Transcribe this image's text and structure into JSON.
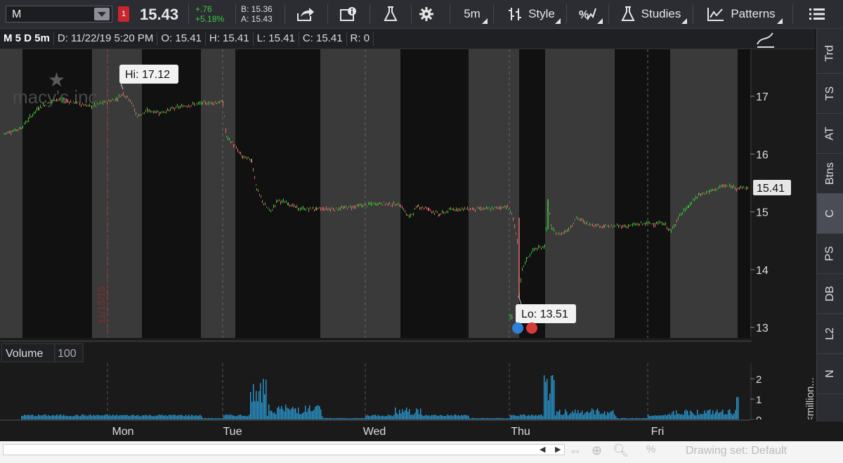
{
  "toolbar": {
    "symbol": "M",
    "alert_count": "1",
    "last_price": "15.43",
    "net_change": "+.76",
    "pct_change": "+5.18%",
    "bid": "B: 15.36",
    "ask": "A: 15.43",
    "timeframe": "5m",
    "style_label": "Style",
    "studies_label": "Studies",
    "patterns_label": "Patterns"
  },
  "infobar": {
    "title": "M 5 D 5m",
    "date": "D: 11/22/19 5:20 PM",
    "open": "O: 15.41",
    "high": "H: 15.41",
    "low": "L: 15.41",
    "close": "C: 15.41",
    "range": "R: 0"
  },
  "chart": {
    "watermark": "macy's inc",
    "hi_label": "Hi: 17.12",
    "lo_label": "Lo: 13.51",
    "price_label": "15.41",
    "date_marker": "11/15/19",
    "price_ticks": [
      "17",
      "16",
      "15",
      "14",
      "13"
    ],
    "day_labels": [
      "Mon",
      "Tue",
      "Wed",
      "Thu",
      "Fri"
    ],
    "volume_label": "Volume",
    "volume_value": "100",
    "volume_ticks": [
      "2",
      "1",
      "0"
    ],
    "volume_unit": "<million...",
    "up_color": "#2fcb2f",
    "down_color": "#e56b6b",
    "volume_color": "#2b9ad3"
  },
  "right_tabs": [
    "Trd",
    "TS",
    "AT",
    "Btns",
    "C",
    "PS",
    "DB",
    "L2",
    "N"
  ],
  "bottom": {
    "drawing_set": "Drawing set: Default"
  }
}
